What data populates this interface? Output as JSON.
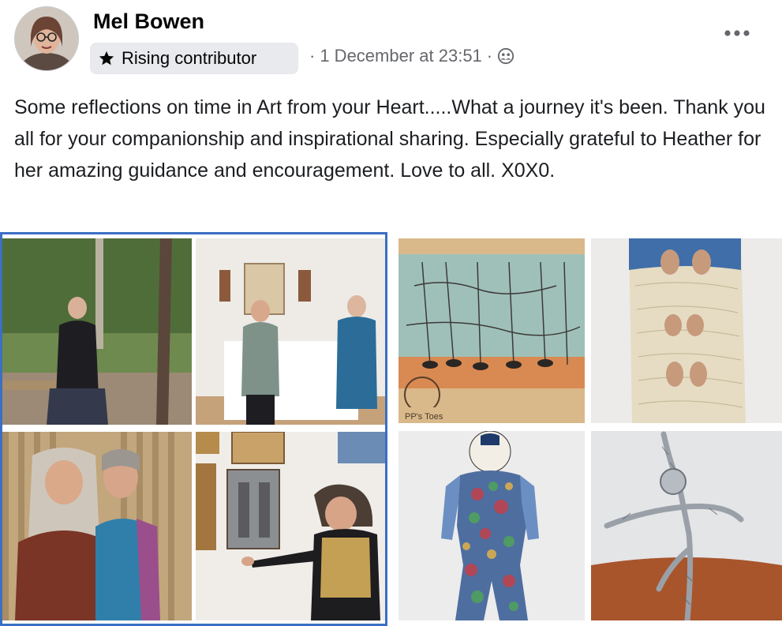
{
  "post": {
    "author": "Mel Bowen",
    "badge": "Rising contributor",
    "timestamp": "1 December at 23:51",
    "separator": "·",
    "privacy_icon": "friends-icon",
    "more_icon": "more-options-icon",
    "text": "Some reflections on time in Art from your Heart.....What a journey it's been. Thank you all for your companionship and inspirational sharing. Especially grateful to Heather for her amazing guidance and encouragement. Love to all. X0X0."
  },
  "gallery": {
    "photos": [
      {
        "name": "photo-woman-seated-garden"
      },
      {
        "name": "photo-gallery-two-women"
      },
      {
        "name": "photo-two-women-smiling"
      },
      {
        "name": "photo-woman-pointing-art"
      },
      {
        "name": "photo-sketch-feet-painting"
      },
      {
        "name": "photo-embroidered-feet"
      },
      {
        "name": "photo-painted-figure-cutout"
      },
      {
        "name": "photo-wire-sculpture"
      }
    ],
    "snippet_text": "PP's Toes",
    "selected_border_color": "#3b6fc4"
  }
}
